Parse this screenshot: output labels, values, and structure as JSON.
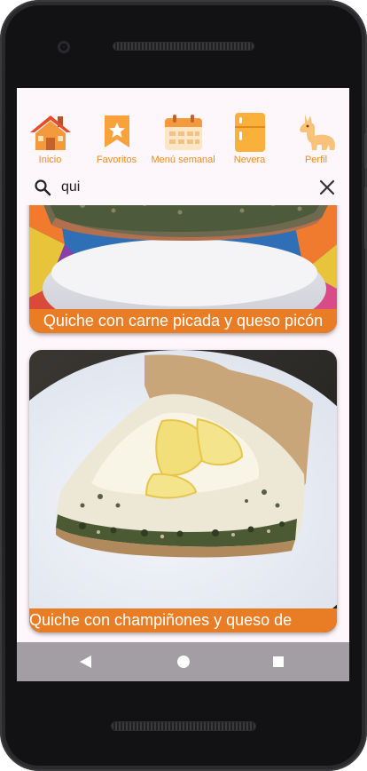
{
  "tabs": [
    {
      "label": "Inicio",
      "icon": "house-icon"
    },
    {
      "label": "Favoritos",
      "icon": "bookmark-star-icon"
    },
    {
      "label": "Menú semanal",
      "icon": "calendar-icon"
    },
    {
      "label": "Nevera",
      "icon": "fridge-icon"
    },
    {
      "label": "Perfil",
      "icon": "llama-icon"
    }
  ],
  "search": {
    "value": "qui"
  },
  "recipes": [
    {
      "title": "Quiche con carne picada y queso picón"
    },
    {
      "title": "Quiche con champiñones y queso de"
    }
  ],
  "colors": {
    "accent": "#ef8a1f",
    "caption_bg": "#e87d25",
    "screen_bg": "#fdf6fb",
    "navbar_bg": "#a29ea3"
  },
  "system_nav": [
    {
      "icon": "back-triangle-icon"
    },
    {
      "icon": "home-circle-icon"
    },
    {
      "icon": "recents-square-icon"
    }
  ]
}
